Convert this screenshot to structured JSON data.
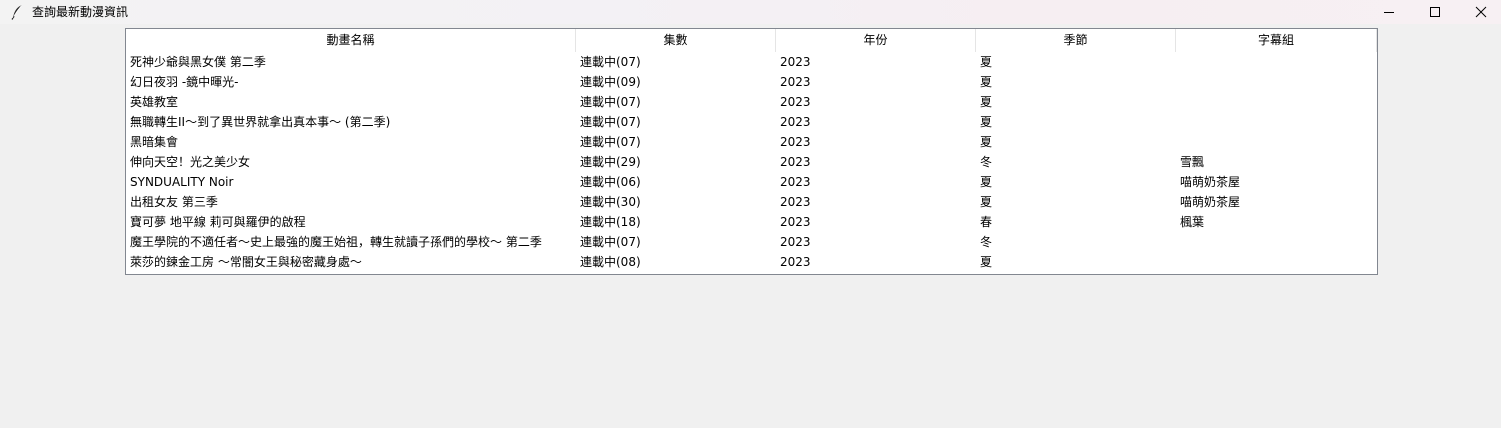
{
  "window": {
    "title": "查詢最新動漫資訊",
    "icon": "feather-icon",
    "controls": [
      "minimize-icon",
      "maximize-icon",
      "close-icon"
    ]
  },
  "table": {
    "columns": [
      "動畫名稱",
      "集數",
      "年份",
      "季節",
      "字幕組"
    ],
    "rows": [
      [
        "死神少爺與黑女僕 第二季",
        "連載中(07)",
        "2023",
        "夏",
        ""
      ],
      [
        "幻日夜羽 -鏡中暉光-",
        "連載中(09)",
        "2023",
        "夏",
        ""
      ],
      [
        "英雄教室",
        "連載中(07)",
        "2023",
        "夏",
        ""
      ],
      [
        "無職轉生II～到了異世界就拿出真本事～ (第二季)",
        "連載中(07)",
        "2023",
        "夏",
        ""
      ],
      [
        "黑暗集會",
        "連載中(07)",
        "2023",
        "夏",
        ""
      ],
      [
        "伸向天空！光之美少女",
        "連載中(29)",
        "2023",
        "冬",
        "雪飄"
      ],
      [
        "SYNDUALITY Noir",
        "連載中(06)",
        "2023",
        "夏",
        "喵萌奶茶屋"
      ],
      [
        "出租女友 第三季",
        "連載中(30)",
        "2023",
        "夏",
        "喵萌奶茶屋"
      ],
      [
        "寶可夢 地平線 莉可與羅伊的啟程",
        "連載中(18)",
        "2023",
        "春",
        "楓葉"
      ],
      [
        "魔王學院的不適任者～史上最強的魔王始祖，轉生就讀子孫們的學校～ 第二季",
        "連載中(07)",
        "2023",
        "冬",
        ""
      ],
      [
        "萊莎的鍊金工房 ～常闇女王與秘密藏身處～",
        "連載中(08)",
        "2023",
        "夏",
        ""
      ]
    ]
  }
}
